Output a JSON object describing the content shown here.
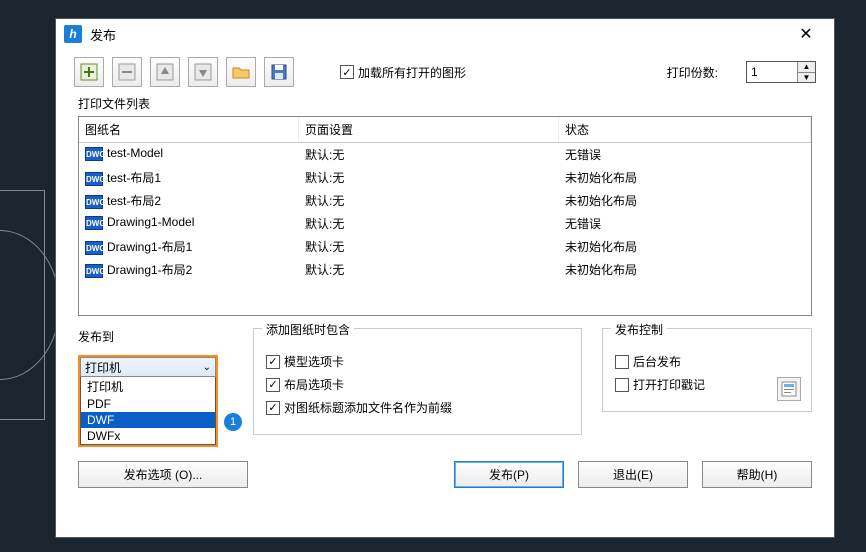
{
  "titlebar": {
    "title": "发布"
  },
  "toolbar": {
    "load_all_label": "加载所有打开的图形",
    "load_all_checked": true,
    "copies_label": "打印份数:",
    "copies_value": "1"
  },
  "list": {
    "label": "打印文件列表",
    "headers": {
      "name": "图纸名",
      "page": "页面设置",
      "status": "状态"
    },
    "rows": [
      {
        "name": "test-Model",
        "page": "默认:无",
        "status": "无错误"
      },
      {
        "name": "test-布局1",
        "page": "默认:无",
        "status": "未初始化布局"
      },
      {
        "name": "test-布局2",
        "page": "默认:无",
        "status": "未初始化布局"
      },
      {
        "name": "Drawing1-Model",
        "page": "默认:无",
        "status": "无错误"
      },
      {
        "name": "Drawing1-布局1",
        "page": "默认:无",
        "status": "未初始化布局"
      },
      {
        "name": "Drawing1-布局2",
        "page": "默认:无",
        "status": "未初始化布局"
      }
    ]
  },
  "publish_to": {
    "title": "发布到",
    "selected": "打印机",
    "options": [
      "打印机",
      "PDF",
      "DWF",
      "DWFx"
    ],
    "highlight_index": 2,
    "badge": "1"
  },
  "add_group": {
    "title": "添加图纸时包含",
    "model_tab": "模型选项卡",
    "layout_tab": "布局选项卡",
    "prefix": "对图纸标题添加文件名作为前缀"
  },
  "control_group": {
    "title": "发布控制",
    "background": "后台发布",
    "stamp": "打开打印戳记"
  },
  "buttons": {
    "options": "发布选项 (O)...",
    "publish": "发布(P)",
    "exit": "退出(E)",
    "help": "帮助(H)"
  }
}
